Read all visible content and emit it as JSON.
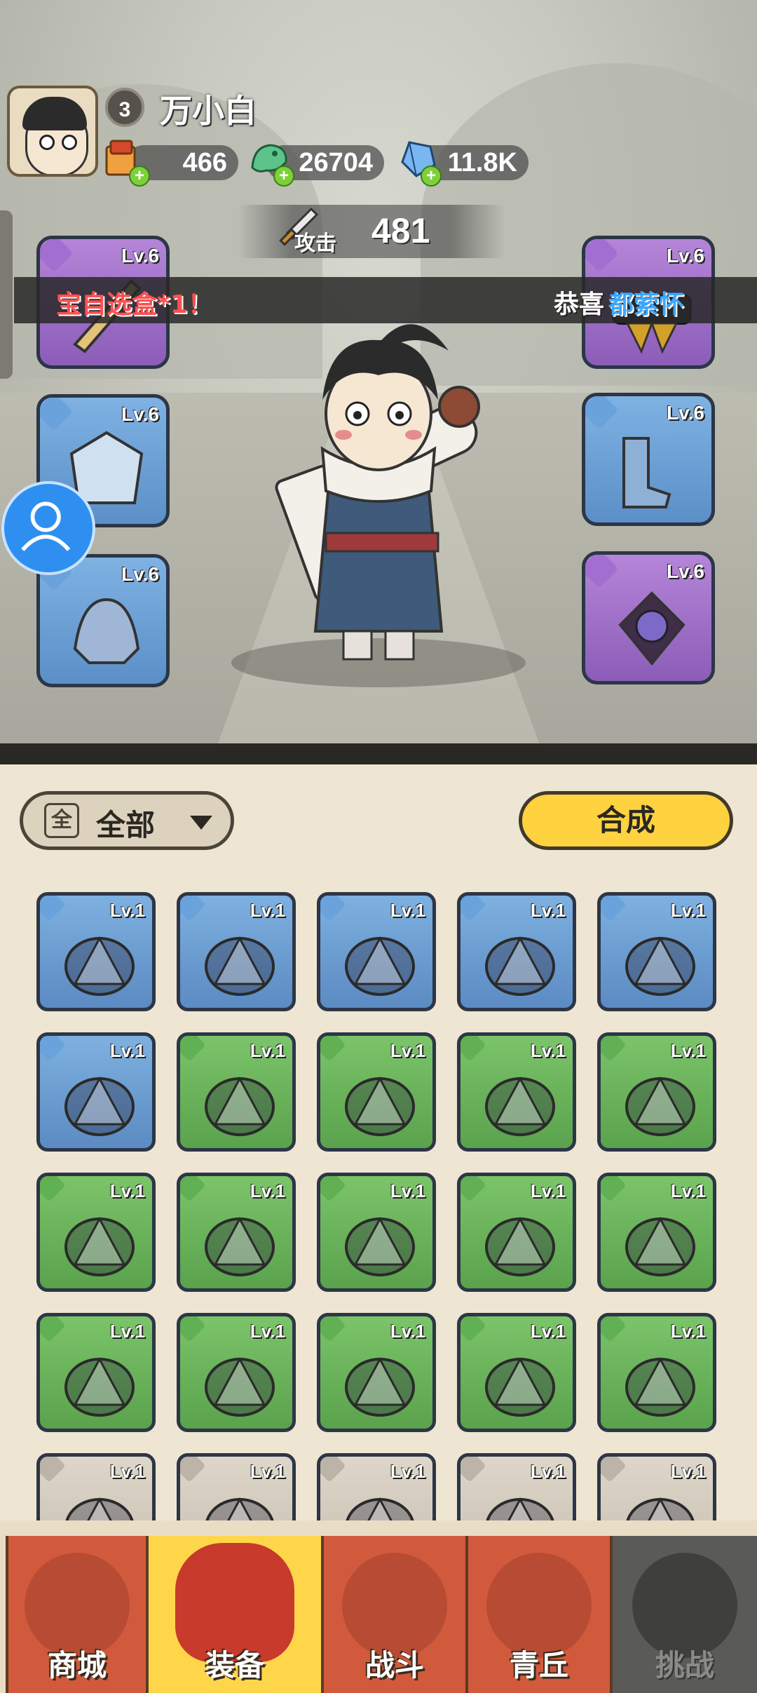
{
  "player": {
    "level": "3",
    "name": "万小白"
  },
  "resources": [
    {
      "name": "coupon",
      "icon": "scroll-coupon-icon",
      "value": "466"
    },
    {
      "name": "jade",
      "icon": "jade-dragon-icon",
      "value": "26704"
    },
    {
      "name": "crystal",
      "icon": "blue-crystal-icon",
      "value": "11.8K"
    }
  ],
  "attack": {
    "label": "攻击",
    "value": "481"
  },
  "marquee": {
    "left_text": "宝自选盒*1！",
    "right_prefix": "恭喜",
    "right_name": "都萦怀"
  },
  "equipped": {
    "left": [
      {
        "level": "Lv.6",
        "rarity": "purple",
        "icon": "weapon-icon"
      },
      {
        "level": "Lv.6",
        "rarity": "blue",
        "icon": "armor-icon"
      },
      {
        "level": "Lv.6",
        "rarity": "blue",
        "icon": "helmet-icon"
      }
    ],
    "right": [
      {
        "level": "Lv.6",
        "rarity": "purple",
        "icon": "belt-icon"
      },
      {
        "level": "Lv.6",
        "rarity": "blue",
        "icon": "boots-icon"
      },
      {
        "level": "Lv.6",
        "rarity": "purple",
        "icon": "amulet-icon"
      }
    ]
  },
  "inventory": {
    "filter_char": "全",
    "filter_label": "全部",
    "craft_label": "合成",
    "items": [
      {
        "level": "Lv.1",
        "rarity": "blue",
        "icon": "bow-icon"
      },
      {
        "level": "Lv.1",
        "rarity": "blue",
        "icon": "crossbow-icon"
      },
      {
        "level": "Lv.1",
        "rarity": "blue",
        "icon": "crossbow-icon"
      },
      {
        "level": "Lv.1",
        "rarity": "blue",
        "icon": "armor-icon"
      },
      {
        "level": "Lv.1",
        "rarity": "blue",
        "icon": "boots-icon"
      },
      {
        "level": "Lv.1",
        "rarity": "blue",
        "icon": "pendant-icon"
      },
      {
        "level": "Lv.1",
        "rarity": "green",
        "icon": "flower-staff-icon"
      },
      {
        "level": "Lv.1",
        "rarity": "green",
        "icon": "flower-staff-icon"
      },
      {
        "level": "Lv.1",
        "rarity": "green",
        "icon": "bow-icon"
      },
      {
        "level": "Lv.1",
        "rarity": "green",
        "icon": "bow-icon"
      },
      {
        "level": "Lv.1",
        "rarity": "green",
        "icon": "branch-staff-icon"
      },
      {
        "level": "Lv.1",
        "rarity": "green",
        "icon": "red-armor-icon"
      },
      {
        "level": "Lv.1",
        "rarity": "green",
        "icon": "lotus-helmet-icon"
      },
      {
        "level": "Lv.1",
        "rarity": "green",
        "icon": "lotus-belt-icon"
      },
      {
        "level": "Lv.1",
        "rarity": "green",
        "icon": "ice-belt-icon"
      },
      {
        "level": "Lv.1",
        "rarity": "green",
        "icon": "ice-belt-icon"
      },
      {
        "level": "Lv.1",
        "rarity": "green",
        "icon": "boots-icon"
      },
      {
        "level": "Lv.1",
        "rarity": "green",
        "icon": "bone-boots-icon"
      },
      {
        "level": "Lv.1",
        "rarity": "green",
        "icon": "claw-necklace-icon"
      },
      {
        "level": "Lv.1",
        "rarity": "green",
        "icon": "claw-necklace-icon"
      },
      {
        "level": "Lv.1",
        "rarity": "grey",
        "icon": "flower-staff-icon"
      },
      {
        "level": "Lv.1",
        "rarity": "grey",
        "icon": "crossbow-icon"
      },
      {
        "level": "Lv.1",
        "rarity": "grey",
        "icon": "armor-icon"
      },
      {
        "level": "Lv.1",
        "rarity": "grey",
        "icon": "lotus-belt-icon"
      },
      {
        "level": "Lv.1",
        "rarity": "grey",
        "icon": "boots-icon"
      }
    ]
  },
  "nav": [
    {
      "label": "商城",
      "icon": "shop-icon",
      "state": "normal"
    },
    {
      "label": "装备",
      "icon": "equipment-helmet-icon",
      "state": "active"
    },
    {
      "label": "战斗",
      "icon": "crossed-swords-icon",
      "state": "normal"
    },
    {
      "label": "青丘",
      "icon": "mountain-icon",
      "state": "normal"
    },
    {
      "label": "挑战",
      "icon": "challenge-orb-icon",
      "state": "locked"
    }
  ],
  "colors": {
    "blue_rarity": "#6aa3dc",
    "purple_rarity": "#a26fd0",
    "green_rarity": "#62b054",
    "grey_rarity": "#c8c0b1",
    "craft_button": "#ffd23f",
    "nav_active": "#ffd64a",
    "nav_normal": "#d15a3c",
    "marquee_red": "#ff5050",
    "marquee_blue": "#3aa6ff"
  }
}
